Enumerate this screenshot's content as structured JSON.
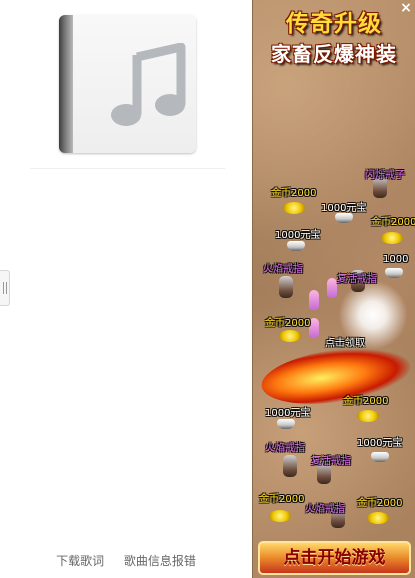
{
  "left_panel": {
    "album_art_icon": "music-note-icon",
    "footer": {
      "download_lyrics": "下载歌词",
      "report_song_info": "歌曲信息报错"
    }
  },
  "ad": {
    "title_line1": "传奇升级",
    "title_line2": "家畜反爆神装",
    "close_label": "×",
    "labels": {
      "l1": "闪烁戒子",
      "l2": "金币2000",
      "l3": "1000元宝",
      "l4": "金币2000",
      "l5": "1000元宝",
      "l6": "火焰戒指",
      "l7": "复活戒指",
      "l8": "1000",
      "l9": "金币2000",
      "l10": "点击领取",
      "l11": "1000元宝",
      "l12": "金币2000",
      "l13": "火焰戒指",
      "l14": "1000元宝",
      "l15": "复活戒指",
      "l16": "金币2000",
      "l17": "火焰戒指",
      "l18": "金币2000"
    },
    "start_button": "点击开始游戏"
  }
}
